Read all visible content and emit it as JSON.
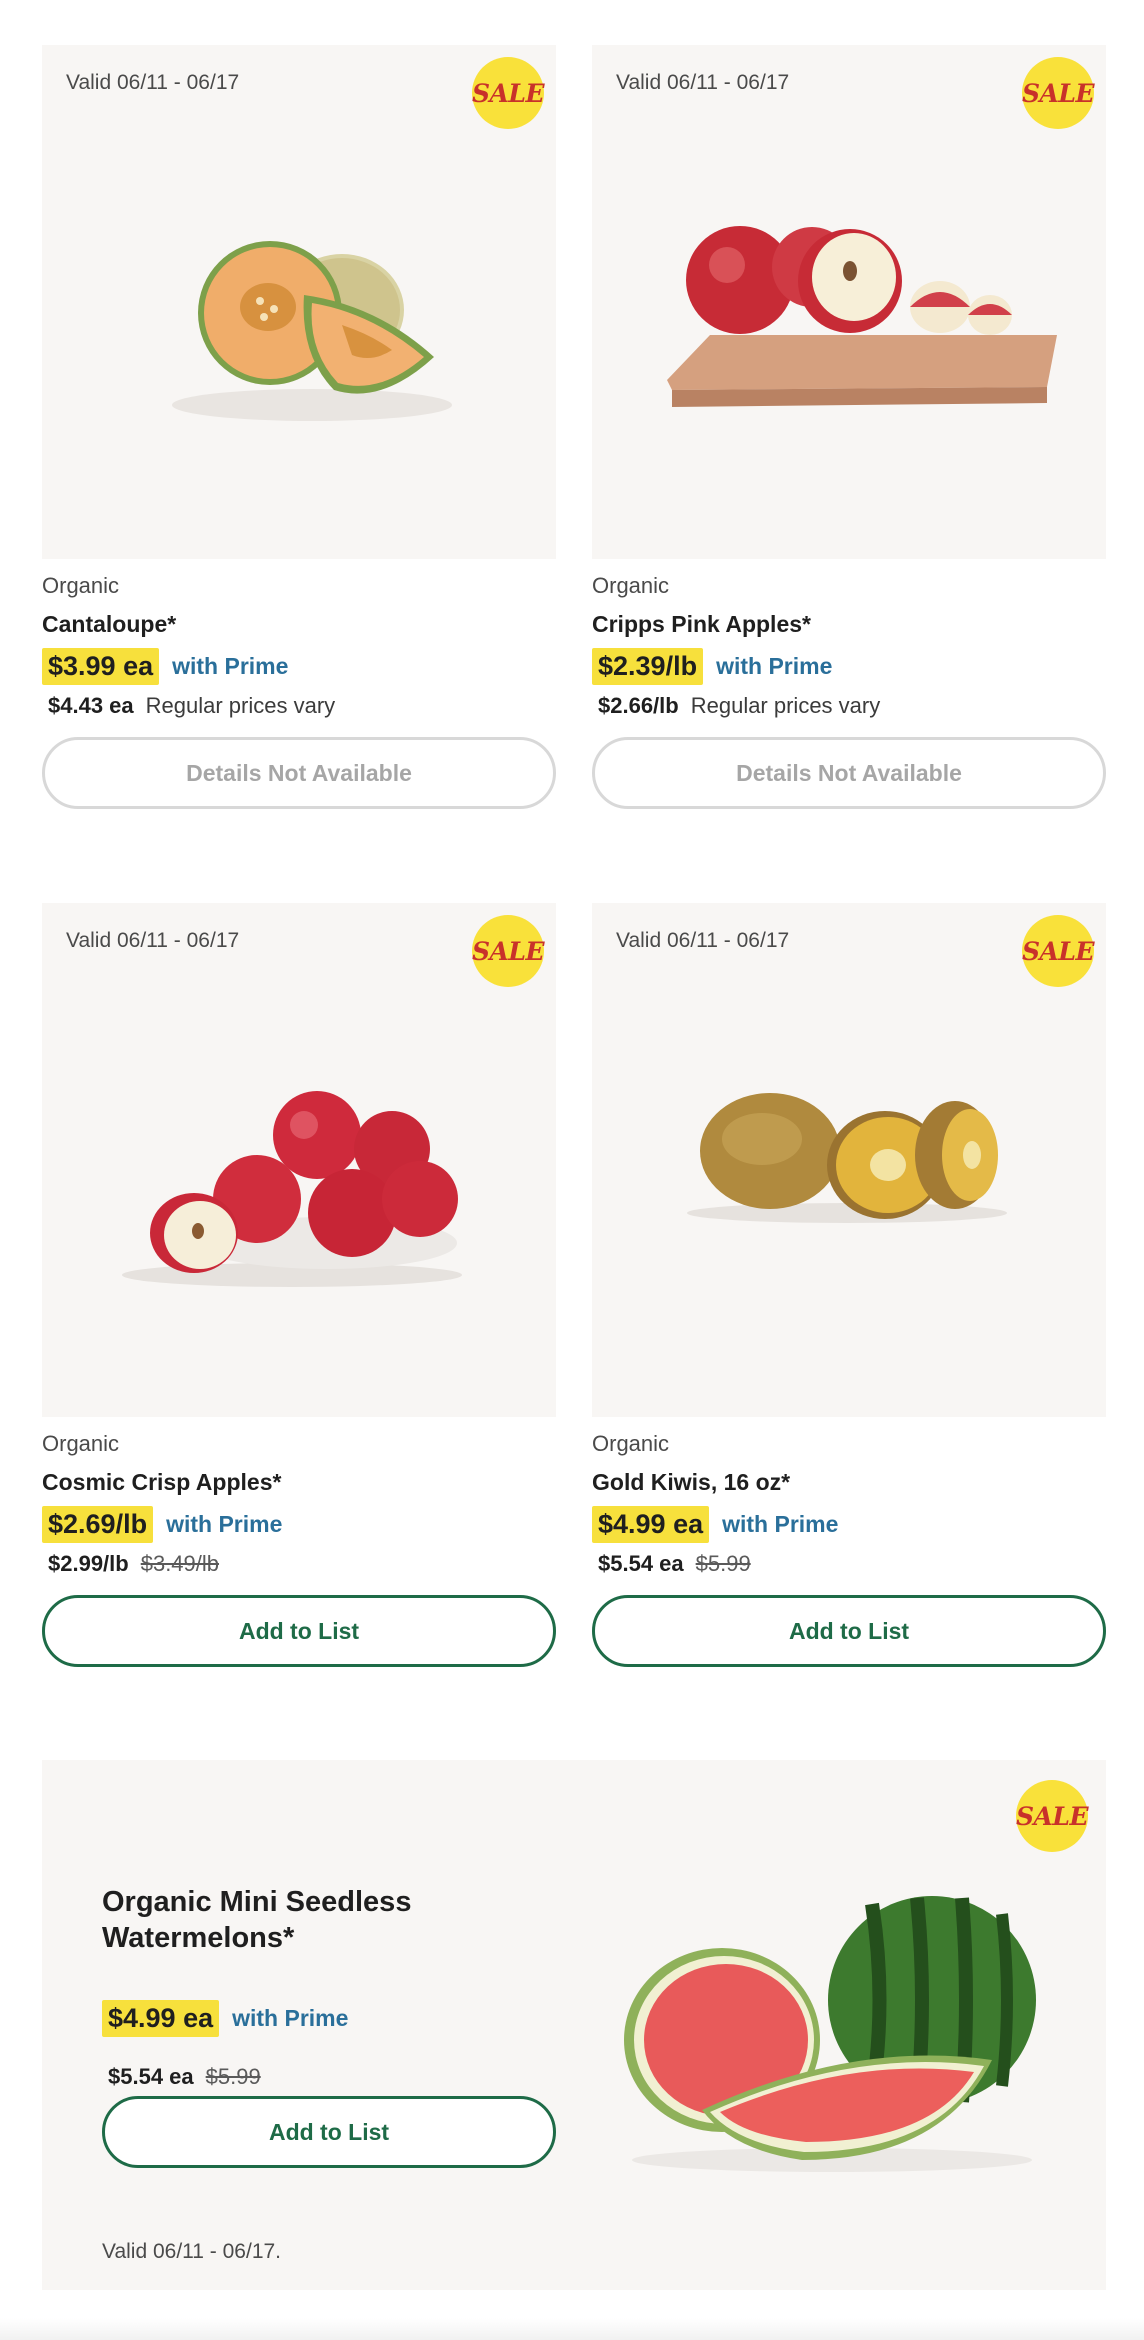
{
  "sale_badge": "SALE",
  "products": [
    {
      "valid": "Valid 06/11 - 06/17",
      "brand": "Organic",
      "name": "Cantaloupe*",
      "prime_price": "$3.99 ea",
      "prime_label": "with Prime",
      "regular_price": "$4.43 ea",
      "regular_note": "Regular prices vary",
      "button": "Details Not Available",
      "button_enabled": false,
      "image_icon": "cantaloupe-image"
    },
    {
      "valid": "Valid 06/11 - 06/17",
      "brand": "Organic",
      "name": "Cripps Pink Apples*",
      "prime_price": "$2.39/lb",
      "prime_label": "with Prime",
      "regular_price": "$2.66/lb",
      "regular_note": "Regular prices vary",
      "button": "Details Not Available",
      "button_enabled": false,
      "image_icon": "apples-on-board-image"
    },
    {
      "valid": "Valid 06/11 - 06/17",
      "brand": "Organic",
      "name": "Cosmic Crisp Apples*",
      "prime_price": "$2.69/lb",
      "prime_label": "with Prime",
      "regular_price": "$2.99/lb",
      "strike_price": "$3.49/lb",
      "button": "Add to List",
      "button_enabled": true,
      "image_icon": "apples-on-plate-image"
    },
    {
      "valid": "Valid 06/11 - 06/17",
      "brand": "Organic",
      "name": "Gold Kiwis, 16 oz*",
      "prime_price": "$4.99 ea",
      "prime_label": "with Prime",
      "regular_price": "$5.54 ea",
      "strike_price": "$5.99",
      "button": "Add to List",
      "button_enabled": true,
      "image_icon": "gold-kiwi-image"
    }
  ],
  "feature": {
    "name": "Organic Mini Seedless Watermelons*",
    "prime_price": "$4.99 ea",
    "prime_label": "with Prime",
    "regular_price": "$5.54 ea",
    "strike_price": "$5.99",
    "button": "Add to List",
    "valid": "Valid 06/11 - 06/17.",
    "image_icon": "watermelon-image"
  },
  "colors": {
    "highlight": "#f7e03c",
    "prime": "#2a6f9a",
    "button_active": "#1e6b47",
    "button_disabled": "#d8d8d8",
    "sale_text": "#c8322a",
    "card_bg": "#f8f6f4"
  }
}
